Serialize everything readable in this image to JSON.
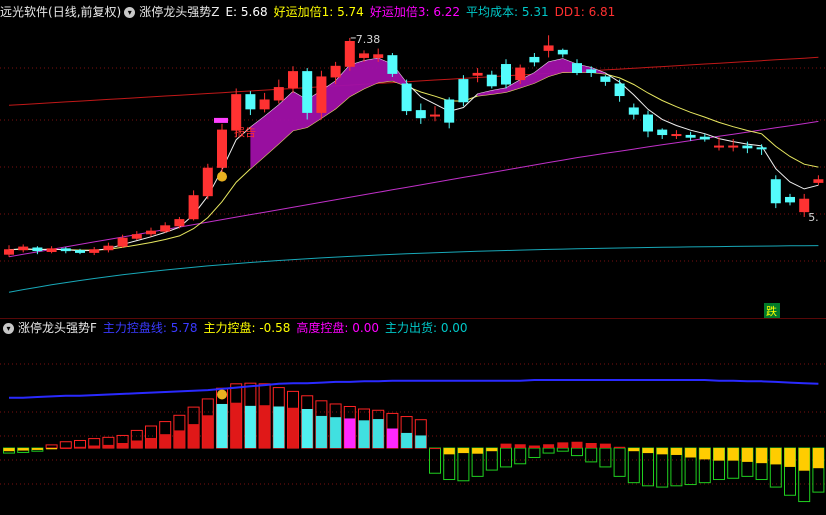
{
  "header_top": {
    "app_name": "远光软件",
    "period": "(日线,前复权)",
    "indicator": "涨停龙头强势Z",
    "items": [
      {
        "label": "E: 5.68",
        "color": "#ffffff"
      },
      {
        "label": "好运加倍1: 5.74",
        "color": "#ffff00"
      },
      {
        "label": "好运加倍3: 6.22",
        "color": "#ff00ff"
      },
      {
        "label": "平均成本: 5.31",
        "color": "#00c8c8"
      },
      {
        "label": "DD1: 6.81",
        "color": "#ff3030"
      }
    ]
  },
  "header_bottom": {
    "indicator": "涨停龙头强势F",
    "items": [
      {
        "label": "主力控盘线: 5.78",
        "color": "#3a3aff"
      },
      {
        "label": "主力控盘: -0.58",
        "color": "#ffff00"
      },
      {
        "label": "高度控盘: 0.00",
        "color": "#ff00ff"
      },
      {
        "label": "主力出货: 0.00",
        "color": "#00c8c8"
      }
    ]
  },
  "price_labels": {
    "high": "7.38",
    "low": "5.",
    "signal": "报告",
    "drop": "跌"
  },
  "chart_data": {
    "type": "candlestick",
    "price_range": [
      4.35,
      7.6
    ],
    "candles": [
      [
        4.98,
        5.03,
        5.08,
        4.95
      ],
      [
        5.03,
        5.06,
        5.09,
        5.0
      ],
      [
        5.05,
        5.02,
        5.07,
        4.98
      ],
      [
        5.01,
        5.04,
        5.07,
        4.99
      ],
      [
        5.04,
        5.02,
        5.06,
        4.99
      ],
      [
        5.02,
        5.0,
        5.04,
        4.98
      ],
      [
        5.0,
        5.03,
        5.06,
        4.97
      ],
      [
        5.03,
        5.07,
        5.11,
        5.0
      ],
      [
        5.07,
        5.16,
        5.2,
        5.05
      ],
      [
        5.16,
        5.2,
        5.24,
        5.14
      ],
      [
        5.21,
        5.24,
        5.28,
        5.18
      ],
      [
        5.24,
        5.3,
        5.34,
        5.22
      ],
      [
        5.3,
        5.37,
        5.4,
        5.27
      ],
      [
        5.38,
        5.64,
        5.7,
        5.36
      ],
      [
        5.64,
        5.95,
        6.0,
        5.6
      ],
      [
        5.96,
        6.38,
        6.45,
        5.9
      ],
      [
        6.38,
        6.78,
        6.85,
        6.3
      ],
      [
        6.78,
        6.62,
        6.82,
        6.55
      ],
      [
        6.62,
        6.72,
        6.8,
        6.58
      ],
      [
        6.72,
        6.86,
        6.95,
        6.68
      ],
      [
        6.86,
        7.04,
        7.1,
        6.8
      ],
      [
        7.04,
        6.58,
        7.08,
        6.5
      ],
      [
        6.58,
        6.98,
        7.05,
        6.5
      ],
      [
        6.98,
        7.1,
        7.15,
        6.9
      ],
      [
        7.1,
        7.38,
        7.42,
        7.05
      ],
      [
        7.2,
        7.24,
        7.28,
        7.15
      ],
      [
        7.2,
        7.23,
        7.3,
        7.15
      ],
      [
        7.22,
        7.02,
        7.25,
        6.98
      ],
      [
        6.9,
        6.6,
        6.95,
        6.55
      ],
      [
        6.6,
        6.52,
        6.68,
        6.45
      ],
      [
        6.55,
        6.55,
        6.65,
        6.48
      ],
      [
        6.72,
        6.47,
        6.75,
        6.4
      ],
      [
        6.95,
        6.7,
        7.0,
        6.65
      ],
      [
        7.0,
        7.02,
        7.08,
        6.92
      ],
      [
        7.0,
        6.88,
        7.05,
        6.85
      ],
      [
        7.12,
        6.9,
        7.18,
        6.85
      ],
      [
        6.95,
        7.08,
        7.12,
        6.9
      ],
      [
        7.2,
        7.15,
        7.25,
        7.1
      ],
      [
        7.28,
        7.33,
        7.45,
        7.2
      ],
      [
        7.28,
        7.24,
        7.3,
        7.2
      ],
      [
        7.13,
        7.03,
        7.18,
        7.0
      ],
      [
        7.06,
        7.03,
        7.1,
        6.98
      ],
      [
        6.98,
        6.93,
        7.0,
        6.88
      ],
      [
        6.9,
        6.77,
        6.95,
        6.7
      ],
      [
        6.63,
        6.56,
        6.68,
        6.5
      ],
      [
        6.55,
        6.37,
        6.6,
        6.3
      ],
      [
        6.38,
        6.33,
        6.4,
        6.28
      ],
      [
        6.33,
        6.33,
        6.38,
        6.28
      ],
      [
        6.32,
        6.3,
        6.36,
        6.26
      ],
      [
        6.3,
        6.28,
        6.34,
        6.25
      ],
      [
        6.2,
        6.2,
        6.3,
        6.15
      ],
      [
        6.2,
        6.2,
        6.28,
        6.14
      ],
      [
        6.2,
        6.18,
        6.25,
        6.12
      ],
      [
        6.18,
        6.17,
        6.22,
        6.1
      ],
      [
        5.82,
        5.56,
        5.87,
        5.5
      ],
      [
        5.62,
        5.57,
        5.66,
        5.53
      ],
      [
        5.46,
        5.6,
        5.66,
        5.4
      ],
      [
        5.79,
        5.82,
        5.87,
        5.76
      ]
    ],
    "bottom_range": [
      -1.0,
      1.7
    ],
    "control_line": [
      0.8,
      0.8,
      0.81,
      0.82,
      0.83,
      0.83,
      0.84,
      0.85,
      0.86,
      0.87,
      0.88,
      0.89,
      0.9,
      0.91,
      0.92,
      0.94,
      0.96,
      0.98,
      1.0,
      1.02,
      1.03,
      1.03,
      1.04,
      1.05,
      1.05,
      1.06,
      1.06,
      1.07,
      1.07,
      1.07,
      1.07,
      1.07,
      1.07,
      1.07,
      1.07,
      1.07,
      1.07,
      1.08,
      1.08,
      1.08,
      1.08,
      1.08,
      1.08,
      1.08,
      1.08,
      1.08,
      1.08,
      1.08,
      1.08,
      1.08,
      1.07,
      1.07,
      1.06,
      1.06,
      1.05,
      1.04,
      1.03,
      1.02
    ],
    "histogram": [
      -0.05,
      -0.04,
      -0.03,
      -0.02,
      0.0,
      0.02,
      0.04,
      0.05,
      0.08,
      0.12,
      0.16,
      0.22,
      0.28,
      0.38,
      0.52,
      0.7,
      0.72,
      0.67,
      0.68,
      0.66,
      0.64,
      0.62,
      0.51,
      0.49,
      0.47,
      0.44,
      0.46,
      0.31,
      0.24,
      0.2,
      0.0,
      -0.1,
      -0.08,
      -0.09,
      -0.05,
      0.07,
      0.06,
      0.04,
      0.06,
      0.09,
      0.1,
      0.08,
      0.07,
      0.02,
      -0.05,
      -0.08,
      -0.1,
      -0.11,
      -0.15,
      -0.18,
      -0.2,
      -0.2,
      -0.22,
      -0.24,
      -0.26,
      -0.3,
      -0.36,
      -0.32
    ],
    "envelope": [
      -0.08,
      -0.07,
      -0.05,
      0.05,
      0.1,
      0.12,
      0.15,
      0.17,
      0.2,
      0.28,
      0.35,
      0.42,
      0.52,
      0.65,
      0.78,
      0.95,
      1.02,
      1.03,
      1.02,
      0.96,
      0.9,
      0.83,
      0.75,
      0.7,
      0.66,
      0.62,
      0.6,
      0.55,
      0.5,
      0.45,
      -0.4,
      -0.5,
      -0.52,
      -0.45,
      -0.35,
      -0.3,
      -0.25,
      -0.15,
      -0.08,
      -0.05,
      -0.12,
      -0.22,
      -0.3,
      -0.45,
      -0.55,
      -0.6,
      -0.62,
      -0.6,
      -0.58,
      -0.55,
      -0.5,
      -0.48,
      -0.45,
      -0.5,
      -0.62,
      -0.75,
      -0.85,
      -0.7
    ]
  }
}
